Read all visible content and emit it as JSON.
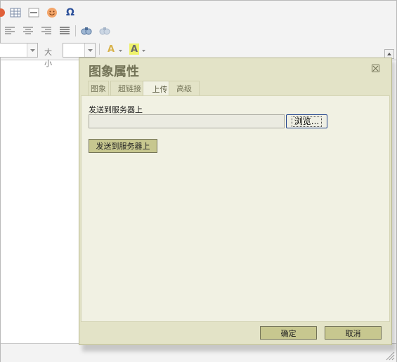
{
  "toolbar": {
    "font_size_label": "大小",
    "font_name_value": "",
    "font_size_value": "",
    "text_color_glyph": "A",
    "bg_color_glyph": "A",
    "omega_glyph": "Ω",
    "icons_row1": [
      "flash-icon",
      "table-icon",
      "horizontal-rule-icon",
      "smiley-icon",
      "special-char-icon"
    ],
    "icons_row2": [
      "align-left-icon",
      "align-center-icon",
      "align-right-icon",
      "align-justify-icon",
      "find-icon",
      "replace-icon"
    ]
  },
  "dialog": {
    "title": "图象属性",
    "tabs": [
      {
        "label": "图象"
      },
      {
        "label": "超链接"
      },
      {
        "label": "上传"
      },
      {
        "label": "高级"
      }
    ],
    "active_tab": "上传",
    "upload_label": "发送到服务器上",
    "file_value": "",
    "browse_label": "浏览...",
    "send_button_label": "发送到服务器上",
    "ok_label": "确定",
    "cancel_label": "取消"
  },
  "colors": {
    "dialog_bg": "#e3e3c7",
    "dialog_body_bg": "#f1f1e3",
    "button_bg": "#c7c78f",
    "title_color": "#737357"
  }
}
